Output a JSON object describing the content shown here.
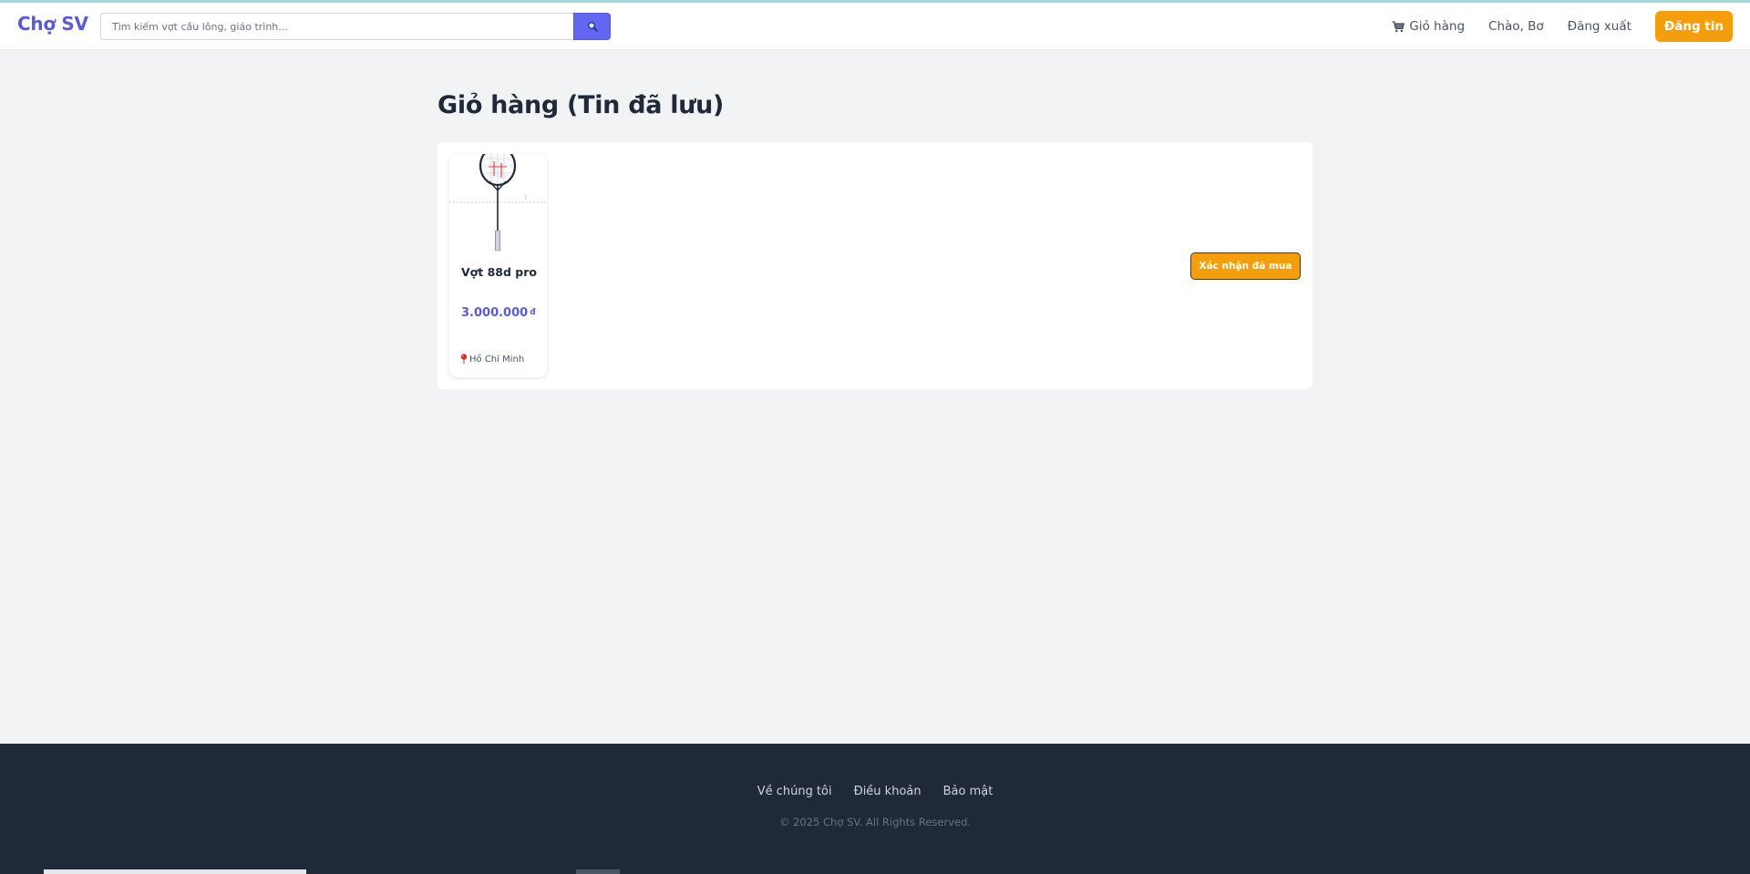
{
  "app": {
    "logo": "Chợ SV"
  },
  "search": {
    "placeholder": "Tìm kiếm vợt cầu lông, giáo trình...",
    "value": "",
    "button_icon": "search-icon"
  },
  "nav": {
    "cart_icon": "cart-icon",
    "cart_label": "Giỏ hàng",
    "greeting": "Chào, Bơ",
    "logout_label": "Đăng xuất",
    "post_label": "Đăng tin"
  },
  "page": {
    "title": "Giỏ hàng (Tin đã lưu)"
  },
  "cart": {
    "items": [
      {
        "name": "Vợt 88d pro",
        "price": "3.000.000",
        "currency": "đ",
        "location_icon": "pin-icon",
        "location": "Hồ Chí Minh"
      }
    ],
    "confirm_label": "Xác nhận đã mua"
  },
  "footer": {
    "links": [
      "Về chúng tôi",
      "Điều khoản",
      "Bảo mật"
    ],
    "copyright": "© 2025 Chợ SV. All Rights Reserved."
  },
  "colors": {
    "brand": "#5b5bd6",
    "search_button": "#6366f1",
    "accent": "#f59e0b",
    "footer_bg": "#1f2937",
    "page_bg": "#f2f3f5"
  }
}
